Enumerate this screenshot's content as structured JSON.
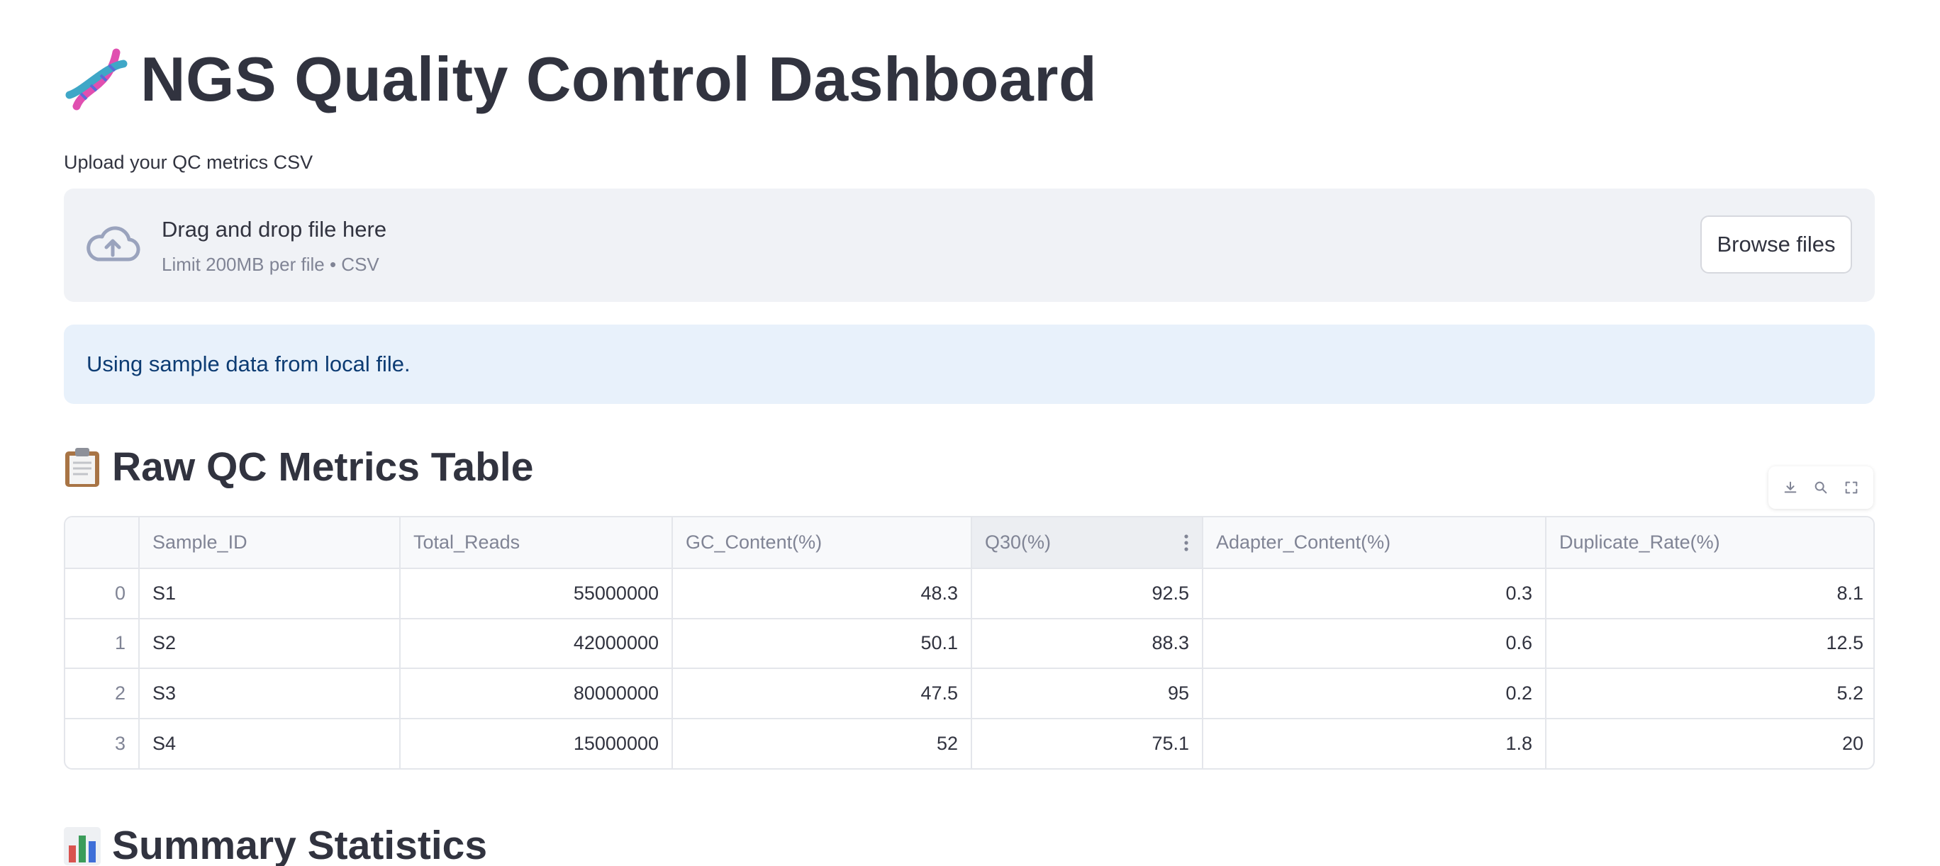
{
  "header": {
    "title": "NGS Quality Control Dashboard",
    "title_icon": "dna-emoji"
  },
  "uploader": {
    "label": "Upload your QC metrics CSV",
    "dropzone_title": "Drag and drop file here",
    "dropzone_subtitle": "Limit 200MB per file • CSV",
    "browse_label": "Browse files",
    "icon": "cloud-upload-icon"
  },
  "info": {
    "message": "Using sample data from local file."
  },
  "sections": {
    "raw_title": "Raw QC Metrics Table",
    "raw_icon": "clipboard-emoji",
    "summary_title": "Summary Statistics",
    "summary_icon": "bar-chart-emoji"
  },
  "toolbar": {
    "icons": [
      "download-icon",
      "search-icon",
      "fullscreen-icon"
    ]
  },
  "table": {
    "columns": [
      "",
      "Sample_ID",
      "Total_Reads",
      "GC_Content(%)",
      "Q30(%)",
      "Adapter_Content(%)",
      "Duplicate_Rate(%)"
    ],
    "rows": [
      [
        "0",
        "S1",
        "55000000",
        "48.3",
        "92.5",
        "0.3",
        "8.1"
      ],
      [
        "1",
        "S2",
        "42000000",
        "50.1",
        "88.3",
        "0.6",
        "12.5"
      ],
      [
        "2",
        "S3",
        "80000000",
        "47.5",
        "95",
        "0.2",
        "5.2"
      ],
      [
        "3",
        "S4",
        "15000000",
        "52",
        "75.1",
        "1.8",
        "20"
      ]
    ]
  },
  "colors": {
    "text": "#31333f",
    "muted": "#808495",
    "dropzone_bg": "#f0f2f6",
    "info_bg": "#e8f1fb",
    "info_text": "#0d3c73"
  }
}
